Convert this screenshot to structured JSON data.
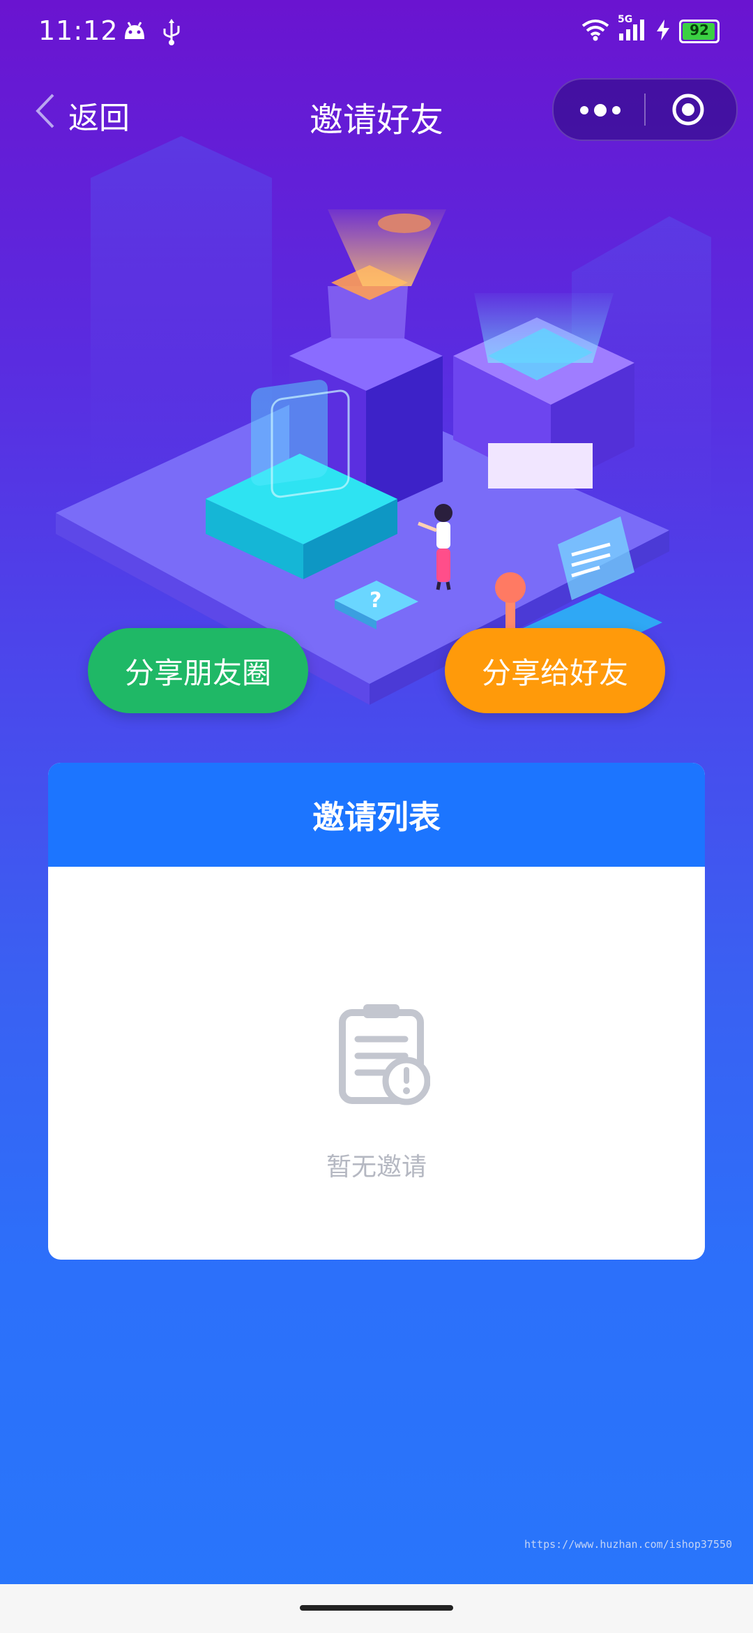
{
  "status_bar": {
    "time": "11:12",
    "network": "5G",
    "battery": "92",
    "icons": [
      "android-icon",
      "usb-icon",
      "wifi-icon",
      "signal-icon",
      "charging-icon",
      "battery-icon"
    ]
  },
  "nav": {
    "back_label": "返回",
    "title": "邀请好友",
    "icons": [
      "chevron-left-icon",
      "more-dots-icon",
      "close-target-icon"
    ]
  },
  "actions": {
    "share_moments": "分享朋友圈",
    "share_friend": "分享给好友"
  },
  "invite_card": {
    "title": "邀请列表",
    "empty_text": "暂无邀请",
    "empty_icon": "clipboard-alert-icon"
  },
  "watermark": "https://www.huzhan.com/ishop37550",
  "colors": {
    "header_blue": "#1c75ff",
    "share_moments_green": "#1fb866",
    "share_friend_orange": "#ff9a0a",
    "battery_green": "#3bd143"
  }
}
